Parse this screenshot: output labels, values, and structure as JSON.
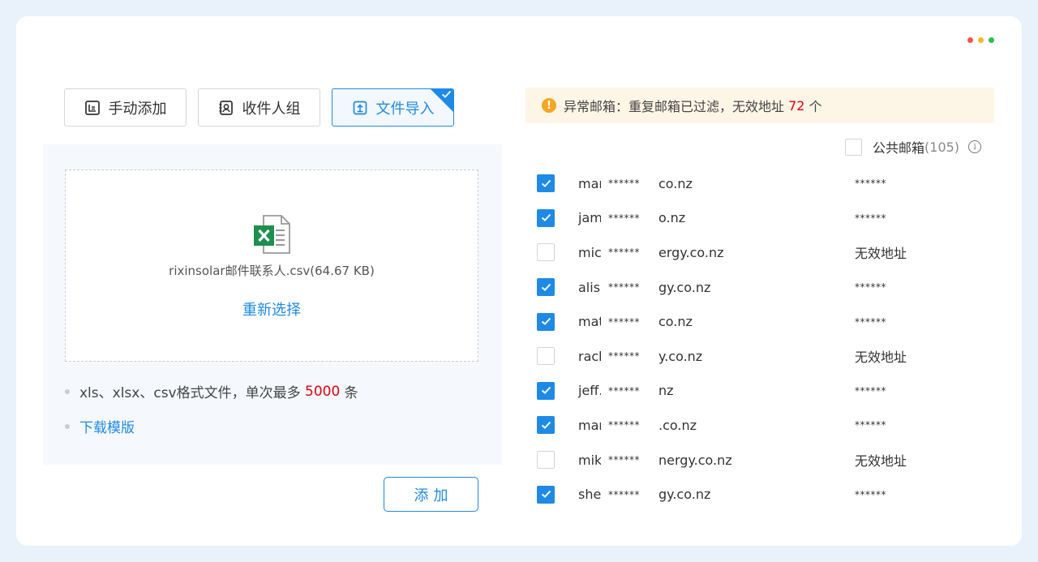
{
  "colors": {
    "accent": "#1f8ae6",
    "dots": [
      "#f5534f",
      "#f7b62c",
      "#2fbf4e"
    ],
    "warning_bg": "#fdf5e6",
    "warning_icon": "#f5a623",
    "highlight": "#e3000f"
  },
  "tabs": [
    {
      "label": "手动添加",
      "icon": "manual-add-icon",
      "active": false
    },
    {
      "label": "收件人组",
      "icon": "contact-group-icon",
      "active": false
    },
    {
      "label": "文件导入",
      "icon": "file-import-icon",
      "active": true
    }
  ],
  "import": {
    "file_icon": "excel-file-icon",
    "file_name": "rixinsolar邮件联系人.csv(64.67 KB)",
    "reselect_label": "重新选择",
    "format_note_prefix": "xls、xlsx、csv格式文件，单次最多 ",
    "format_note_limit": "5000",
    "format_note_suffix": " 条",
    "download_template_label": "下载模版"
  },
  "add_button_label": "添加",
  "warning": {
    "text_prefix": "异常邮箱：重复邮箱已过滤，无效地址 ",
    "invalid_count": "72",
    "text_suffix": " 个"
  },
  "public_mailbox": {
    "label": "公共邮箱",
    "count": "(105)",
    "checked": false
  },
  "recipients": [
    {
      "name": "mar",
      "mask": "******",
      "domain": "co.nz",
      "status": "******",
      "checked": true
    },
    {
      "name": "jam",
      "mask": "******",
      "domain": "o.nz",
      "status": "******",
      "checked": true
    },
    {
      "name": "mic",
      "mask": "******",
      "domain": "ergy.co.nz",
      "status": "无效地址",
      "checked": false
    },
    {
      "name": "alis",
      "mask": "******",
      "domain": "gy.co.nz",
      "status": "******",
      "checked": true
    },
    {
      "name": "mat",
      "mask": "******",
      "domain": "co.nz",
      "status": "******",
      "checked": true
    },
    {
      "name": "rach",
      "mask": "******",
      "domain": "y.co.nz",
      "status": "无效地址",
      "checked": false
    },
    {
      "name": "jeff.",
      "mask": "******",
      "domain": "nz",
      "status": "******",
      "checked": true
    },
    {
      "name": "mar",
      "mask": "******",
      "domain": ".co.nz",
      "status": "******",
      "checked": true
    },
    {
      "name": "mik",
      "mask": "******",
      "domain": "nergy.co.nz",
      "status": "无效地址",
      "checked": false
    },
    {
      "name": "she",
      "mask": "******",
      "domain": "gy.co.nz",
      "status": "******",
      "checked": true
    }
  ]
}
